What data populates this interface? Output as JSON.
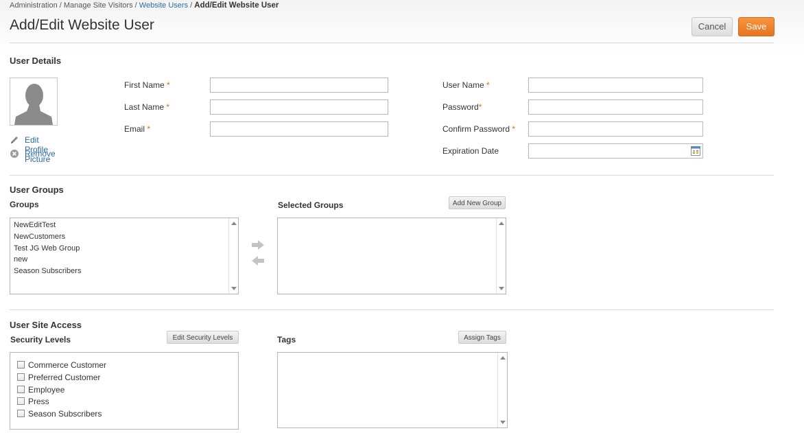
{
  "breadcrumb": {
    "item1": "Administration",
    "item2": "Manage Site Visitors",
    "item3": "Website Users",
    "current": "Add/Edit Website User",
    "sep": "/"
  },
  "header": {
    "title": "Add/Edit Website User",
    "cancel_label": "Cancel",
    "save_label": "Save"
  },
  "user_details": {
    "title": "User Details",
    "edit_picture": "Edit Profile Picture",
    "remove": "Remove",
    "required_mark": "*",
    "first_name_label": "First Name",
    "last_name_label": "Last Name",
    "email_label": "Email",
    "user_name_label": "User Name",
    "password_label": "Password",
    "confirm_password_label": "Confirm Password",
    "expiration_date_label": "Expiration Date",
    "first_name_value": "",
    "last_name_value": "",
    "email_value": "",
    "user_name_value": "",
    "password_value": "",
    "confirm_password_value": "",
    "expiration_date_value": ""
  },
  "user_groups": {
    "title": "User Groups",
    "groups_label": "Groups",
    "selected_groups_label": "Selected Groups",
    "add_new_group": "Add New Group",
    "groups": [
      "NewEditTest",
      "NewCustomers",
      "Test JG Web Group",
      "new",
      "Season Subscribers"
    ]
  },
  "user_site_access": {
    "title": "User Site Access",
    "security_levels_label": "Security Levels",
    "edit_security_levels": "Edit Security Levels",
    "tags_label": "Tags",
    "assign_tags": "Assign Tags",
    "security_levels": [
      "Commerce Customer",
      "Preferred Customer",
      "Employee",
      "Press",
      "Season Subscribers"
    ]
  },
  "colors": {
    "accent_orange": "#e8741d",
    "link_blue": "#2a6aa3",
    "required_orange": "#e06a1a"
  }
}
